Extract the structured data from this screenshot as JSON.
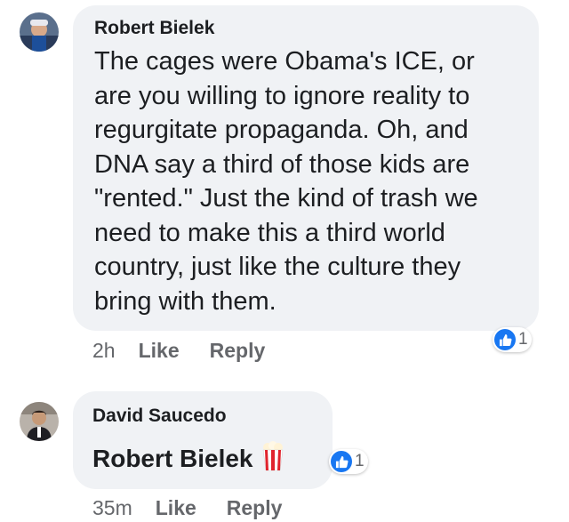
{
  "comments": [
    {
      "author": "Robert Bielek",
      "text": "The cages were Obama's ICE, or are you willing to ignore reality to regurgitate propaganda.  Oh, and DNA say a third of those kids are \"rented.\" Just the kind of trash we need to make this a third world country, just like the culture they bring with them.",
      "lines": [
        "The cages were Obama's ICE, or",
        "are you willing to ignore reality to",
        "regurgitate propaganda.  Oh, and",
        "DNA say a third of those kids are",
        "\"rented.\" Just the kind of trash we",
        "need to make this a third world",
        "country, just like the culture they",
        "bring with them."
      ],
      "time": "2h",
      "like_label": "Like",
      "reply_label": "Reply",
      "reaction_count": "1",
      "reaction_icon": "like-icon",
      "avatar_icon": "user-avatar"
    },
    {
      "author": "David Saucedo",
      "mention": "Robert Bielek",
      "emoji": "popcorn-icon",
      "time": "35m",
      "like_label": "Like",
      "reply_label": "Reply",
      "reaction_count": "1",
      "reaction_icon": "like-icon",
      "avatar_icon": "user-avatar"
    }
  ],
  "colors": {
    "bubble": "#f0f2f5",
    "like_blue": "#1877f2",
    "meta_gray": "#65676b",
    "text": "#1c1e21"
  }
}
